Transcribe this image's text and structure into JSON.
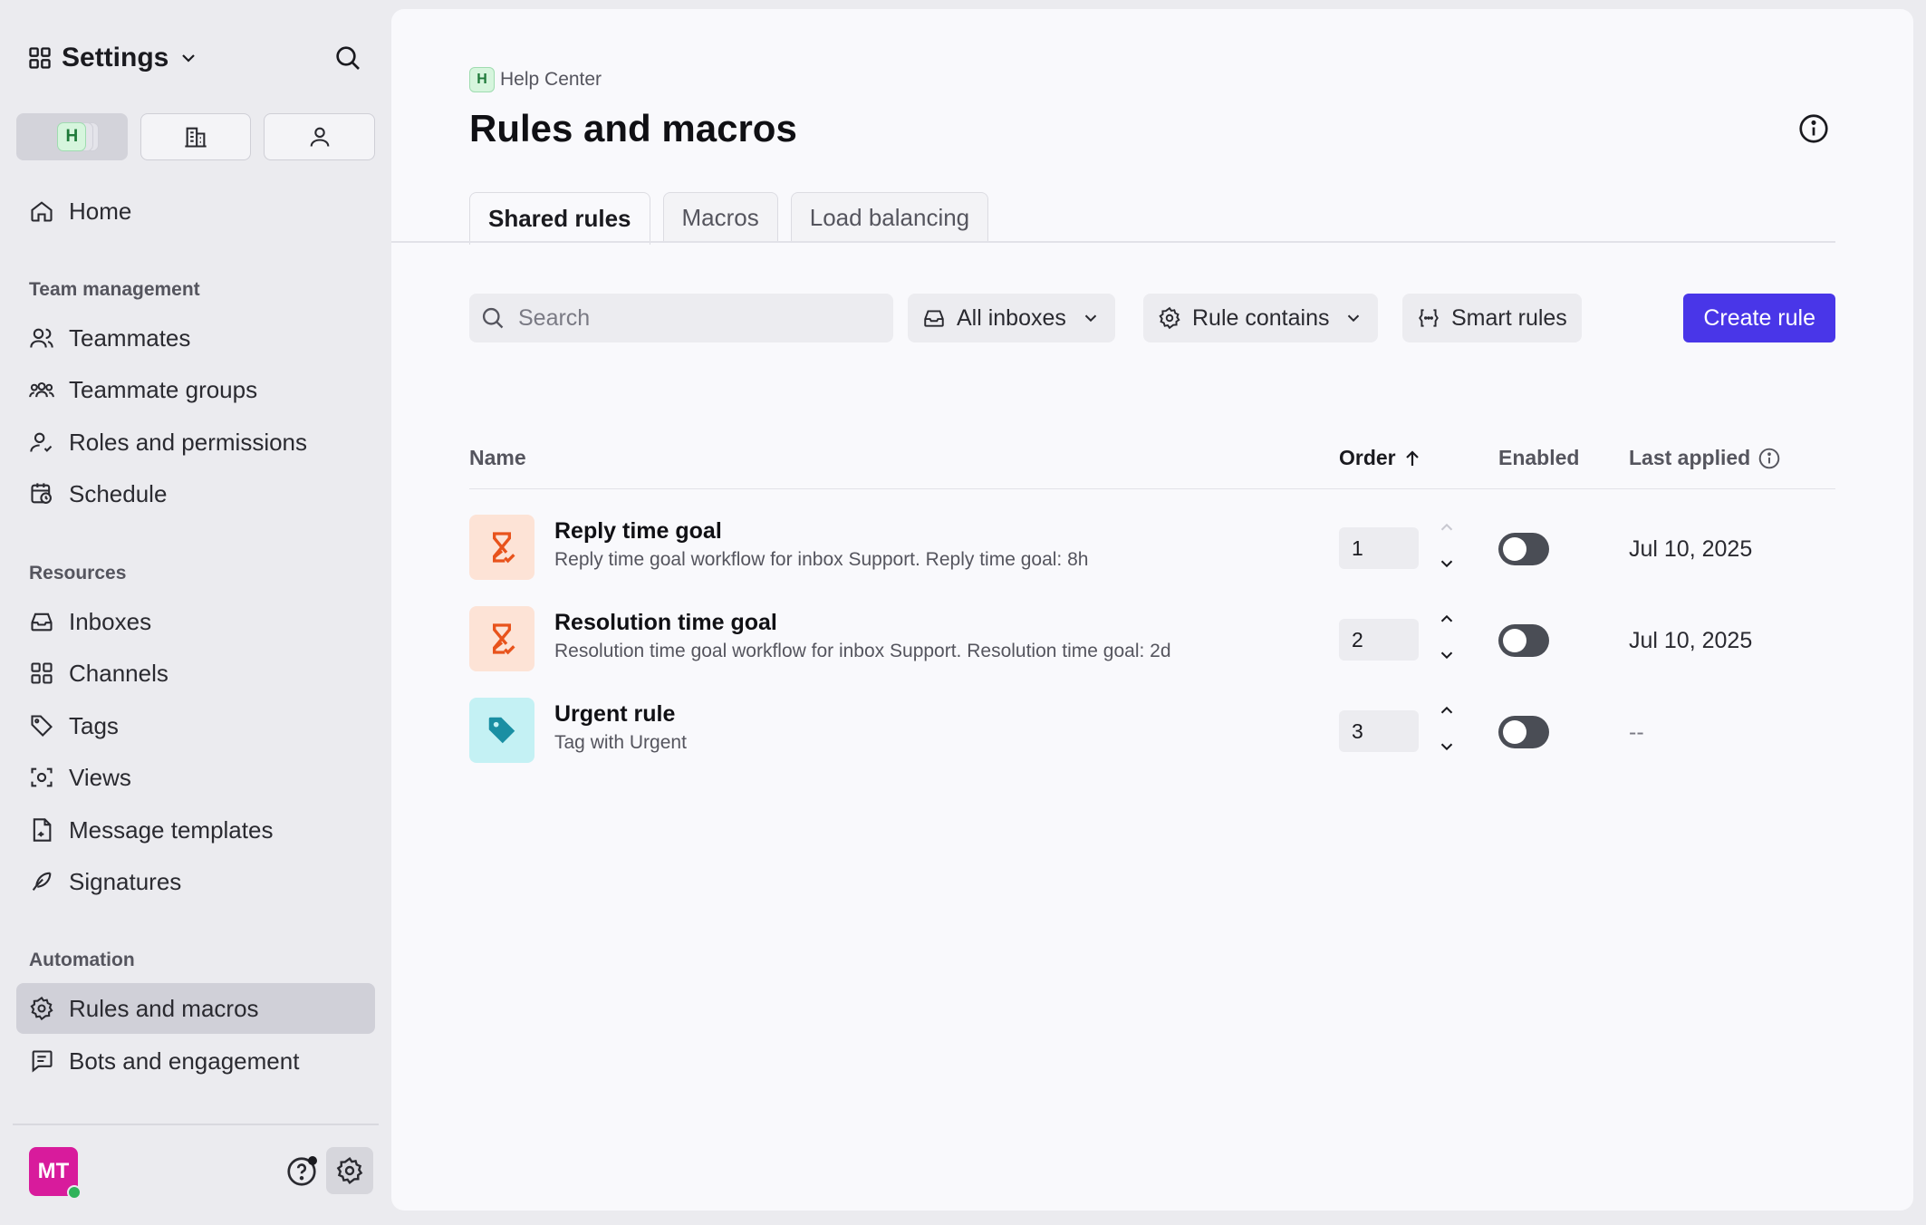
{
  "sidebar": {
    "title": "Settings",
    "scope_badge": "H",
    "nav": {
      "home": "Home",
      "team_section": "Team management",
      "teammates": "Teammates",
      "teammate_groups": "Teammate groups",
      "roles": "Roles and permissions",
      "schedule": "Schedule",
      "resources_section": "Resources",
      "inboxes": "Inboxes",
      "channels": "Channels",
      "tags": "Tags",
      "views": "Views",
      "message_templates": "Message templates",
      "signatures": "Signatures",
      "automation_section": "Automation",
      "rules_and_macros": "Rules and macros",
      "bots": "Bots and engagement"
    },
    "user_initials": "MT"
  },
  "main": {
    "breadcrumb_badge": "H",
    "breadcrumb": "Help Center",
    "title": "Rules and macros",
    "tabs": [
      {
        "label": "Shared rules",
        "active": true
      },
      {
        "label": "Macros",
        "active": false
      },
      {
        "label": "Load balancing",
        "active": false
      }
    ],
    "search_placeholder": "Search",
    "filters": {
      "inboxes": "All inboxes",
      "rule_contains": "Rule contains",
      "smart_rules": "Smart rules"
    },
    "create_button": "Create rule",
    "columns": {
      "name": "Name",
      "order": "Order",
      "enabled": "Enabled",
      "last_applied": "Last applied"
    },
    "rules": [
      {
        "name": "Reply time goal",
        "description": "Reply time goal workflow for inbox Support. Reply time goal: 8h",
        "order": "1",
        "enabled": false,
        "last_applied": "Jul 10, 2025",
        "icon": "hourglass-icon"
      },
      {
        "name": "Resolution time goal",
        "description": "Resolution time goal workflow for inbox Support. Resolution time goal: 2d",
        "order": "2",
        "enabled": false,
        "last_applied": "Jul 10, 2025",
        "icon": "hourglass-icon"
      },
      {
        "name": "Urgent rule",
        "description": "Tag with Urgent",
        "order": "3",
        "enabled": false,
        "last_applied": "--",
        "icon": "tag-icon"
      }
    ]
  },
  "colors": {
    "accent": "#4936e8",
    "avatar": "#d81b9c",
    "toggle_off": "#4a4d55",
    "orange_icon": "#e8531c",
    "teal_icon": "#1a8fa3"
  }
}
